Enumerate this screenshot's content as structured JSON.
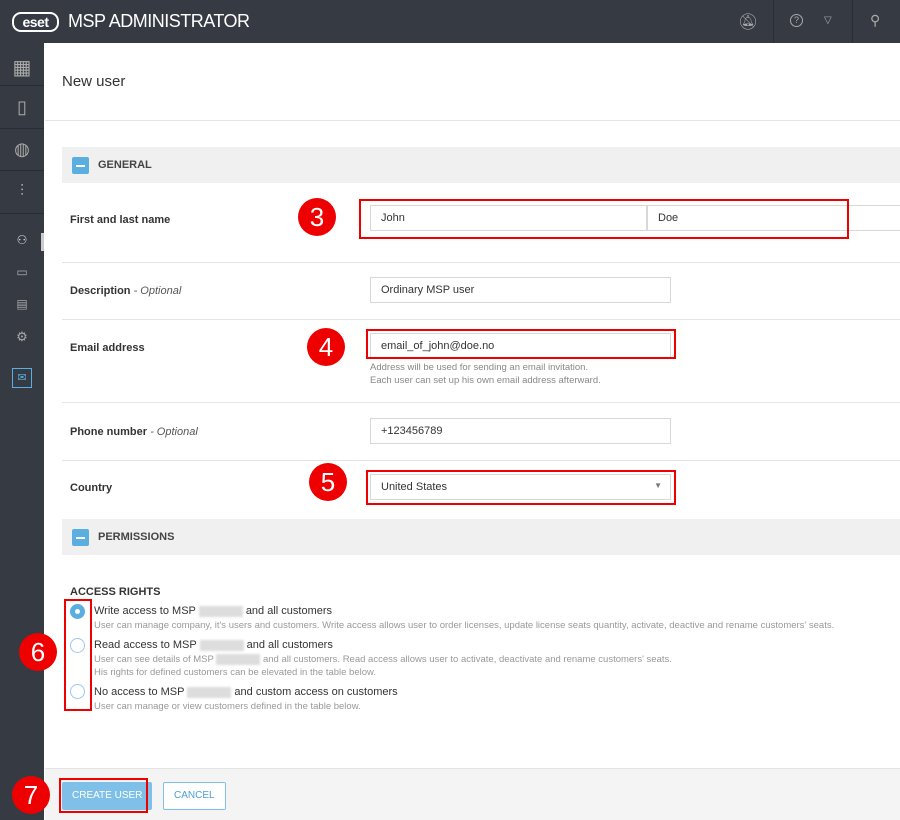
{
  "header": {
    "logo": "eset",
    "title": "MSP ADMINISTRATOR",
    "icons": [
      "notifications-off-icon",
      "help-icon",
      "chevron-down-icon",
      "user-icon"
    ]
  },
  "sidebar": {
    "icons": [
      "dashboard-icon",
      "devices-icon",
      "globe-icon",
      "reports-icon",
      "users-icon",
      "briefcase-icon",
      "clipboard-icon",
      "settings-icon",
      "mail-icon"
    ]
  },
  "page": {
    "title": "New user"
  },
  "general": {
    "heading": "GENERAL",
    "name_label": "First and last name",
    "first_name": "John",
    "last_name": "Doe",
    "description_label": "Description",
    "optional": "- Optional",
    "description": "Ordinary MSP user",
    "email_label": "Email address",
    "email": "email_of_john@doe.no",
    "email_hint1": "Address will be used for sending an email invitation.",
    "email_hint2": "Each user can set up his own email address afterward.",
    "phone_label": "Phone number",
    "phone": "+123456789",
    "country_label": "Country",
    "country": "United States"
  },
  "permissions": {
    "heading": "PERMISSIONS",
    "access_heading": "ACCESS RIGHTS",
    "options": [
      {
        "pre": "Write access to MSP",
        "post": "and all customers",
        "desc": "User can manage company, it's users and customers. Write access allows user to order licenses, update license seats quantity, activate, deactive and rename customers' seats.",
        "selected": true
      },
      {
        "pre": "Read access to MSP",
        "post": "and all customers",
        "desc_pre": "User can see details of MSP",
        "desc_post": "and all customers. Read access allows user to activate, deactivate and rename customers' seats.",
        "desc2": "His rights for defined customers can be elevated in the table below.",
        "selected": false
      },
      {
        "pre": "No access to MSP",
        "post": "and custom access on customers",
        "desc": "User can manage or view customers defined in the table below.",
        "selected": false
      }
    ]
  },
  "footer": {
    "create": "CREATE USER",
    "cancel": "CANCEL"
  },
  "callouts": [
    "3",
    "4",
    "5",
    "6",
    "7"
  ],
  "colors": {
    "accent": "#5aaee0",
    "callout": "#e00000",
    "chrome": "#363a42"
  }
}
